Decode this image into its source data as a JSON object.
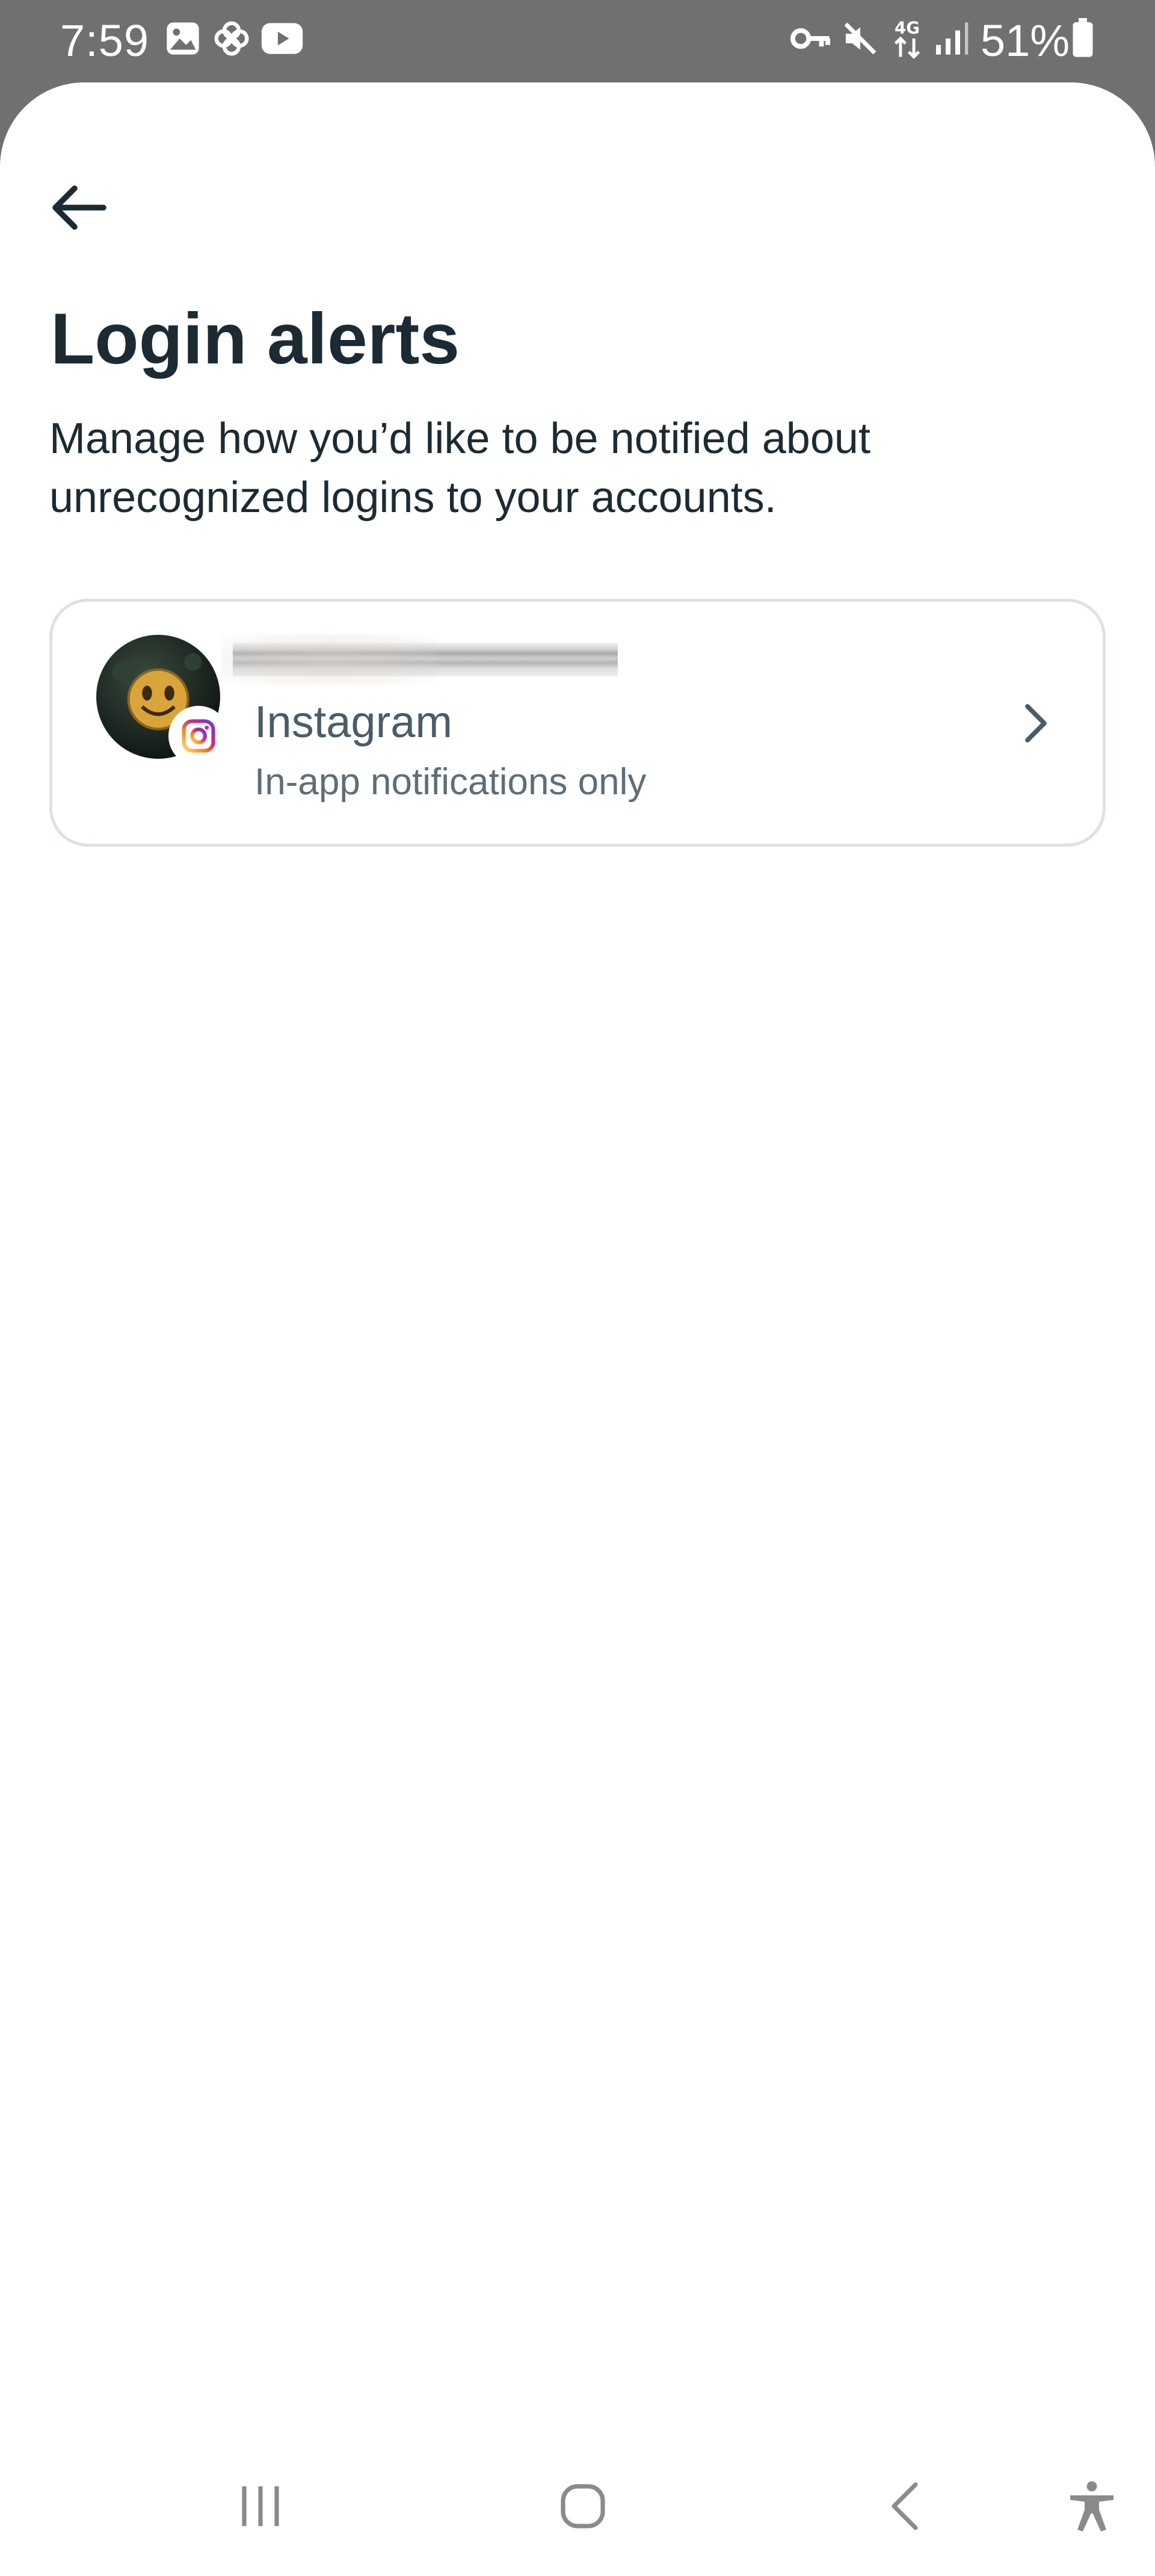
{
  "status_bar": {
    "time": "7:59",
    "battery": "51%",
    "network_type": "4G",
    "icons": [
      "gallery-icon",
      "pinwheel-icon",
      "youtube-icon",
      "vpn-key-icon",
      "mute-icon",
      "network-4g-icon",
      "signal-icon",
      "battery-icon"
    ]
  },
  "header": {
    "back_icon": "arrow-left-icon",
    "title": "Login alerts",
    "description": "Manage how you’d like to be notified about unrecognized logins to your accounts."
  },
  "accounts": [
    {
      "app": "Instagram",
      "setting": "In-app notifications only",
      "badge_icon": "instagram-icon",
      "chevron_icon": "chevron-right-icon"
    }
  ],
  "navigation_bar": {
    "buttons": [
      "recent-apps-icon",
      "home-icon",
      "back-icon",
      "accessibility-icon"
    ]
  },
  "colors": {
    "status_bar_bg": "#707070",
    "sheet_bg": "#ffffff",
    "title_text": "#1c2b33",
    "secondary_text": "#5e6e78",
    "card_border": "#dde1e4"
  }
}
